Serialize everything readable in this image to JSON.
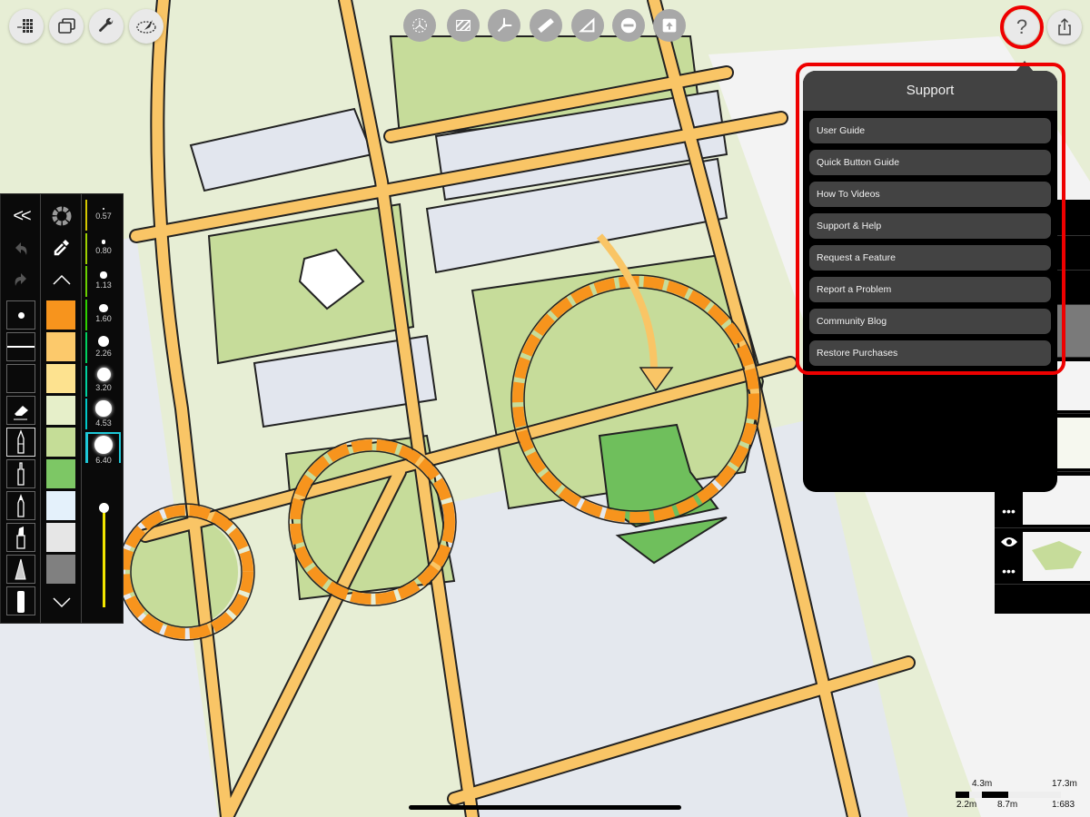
{
  "app": {
    "toolbar_left": [
      {
        "name": "gallery-icon"
      },
      {
        "name": "layers-stack-icon"
      },
      {
        "name": "wrench-icon"
      },
      {
        "name": "lasso-select-icon"
      }
    ],
    "guides": [
      {
        "name": "transform-guide-icon"
      },
      {
        "name": "hatch-fill-icon"
      },
      {
        "name": "perspective-guide-icon"
      },
      {
        "name": "ruler-icon"
      },
      {
        "name": "set-square-icon"
      },
      {
        "name": "ellipse-guide-icon"
      },
      {
        "name": "image-import-icon"
      }
    ],
    "help_label": "?",
    "share_icon": "share-icon"
  },
  "support_menu": {
    "title": "Support",
    "items": [
      {
        "label": "User Guide"
      },
      {
        "label": "Quick Button Guide"
      },
      {
        "label": "How To Videos"
      },
      {
        "label": "Support & Help"
      },
      {
        "label": "Request a Feature"
      },
      {
        "label": "Report a Problem"
      },
      {
        "label": "Community Blog"
      },
      {
        "label": "Restore Purchases"
      }
    ]
  },
  "palette": {
    "collapse_label": "<<",
    "swatches": [
      "#f7941d",
      "#fcc96b",
      "#fde28f",
      "#e6efc9",
      "#c5dd97",
      "#7dc765",
      "#e4f1fb",
      "#e6e6e6",
      "#808080"
    ],
    "brush_sizes": [
      "0.57",
      "0.80",
      "1.13",
      "1.60",
      "2.26",
      "3.20",
      "4.53",
      "6.40"
    ],
    "selected_size": "6.40",
    "opacity_level": 1.0
  },
  "scale_bar": {
    "top_left": "4.3m",
    "top_right": "17.3m",
    "bottom_a": "2.2m",
    "bottom_b": "8.7m",
    "ratio": "1:683"
  },
  "colors": {
    "highlight": "#ee0000",
    "accent_select": "#1ec8d8",
    "popover_header": "#424242",
    "popover_item": "#434343"
  }
}
